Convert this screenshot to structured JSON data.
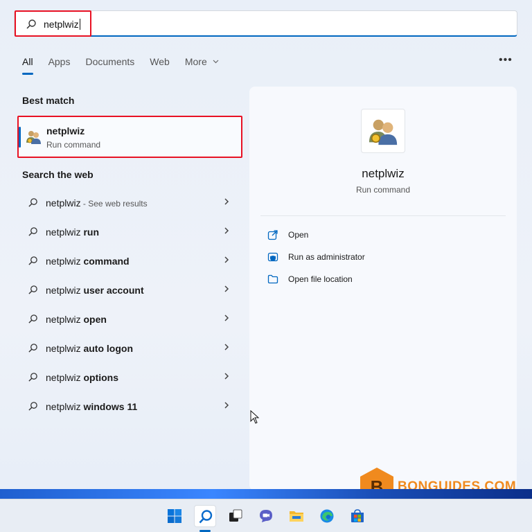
{
  "search": {
    "query": "netplwiz"
  },
  "tabs": [
    {
      "label": "All",
      "active": true
    },
    {
      "label": "Apps"
    },
    {
      "label": "Documents"
    },
    {
      "label": "Web"
    },
    {
      "label": "More"
    }
  ],
  "best_match": {
    "title": "Best match",
    "name": "netplwiz",
    "subtitle": "Run command"
  },
  "search_web": {
    "title": "Search the web",
    "items": [
      {
        "prefix": "netplwiz",
        "bold": "",
        "extra": " - See web results"
      },
      {
        "prefix": "netplwiz ",
        "bold": "run",
        "extra": ""
      },
      {
        "prefix": "netplwiz ",
        "bold": "command",
        "extra": ""
      },
      {
        "prefix": "netplwiz ",
        "bold": "user account",
        "extra": ""
      },
      {
        "prefix": "netplwiz ",
        "bold": "open",
        "extra": ""
      },
      {
        "prefix": "netplwiz ",
        "bold": "auto logon",
        "extra": ""
      },
      {
        "prefix": "netplwiz ",
        "bold": "options",
        "extra": ""
      },
      {
        "prefix": "netplwiz ",
        "bold": "windows 11",
        "extra": ""
      }
    ]
  },
  "preview": {
    "name": "netplwiz",
    "subtitle": "Run command",
    "actions": [
      {
        "label": "Open",
        "icon": "open-icon"
      },
      {
        "label": "Run as administrator",
        "icon": "shield-icon"
      },
      {
        "label": "Open file location",
        "icon": "folder-icon"
      }
    ]
  },
  "watermark": {
    "text": "BONGUIDES.COM",
    "letter": "B"
  },
  "taskbar": {
    "icons": [
      "windows-start-icon",
      "search-icon",
      "task-view-icon",
      "chat-icon",
      "file-explorer-icon",
      "edge-icon",
      "store-icon"
    ]
  },
  "colors": {
    "accent": "#0067c0",
    "highlight": "#e81123",
    "watermark": "#f08a1e"
  }
}
